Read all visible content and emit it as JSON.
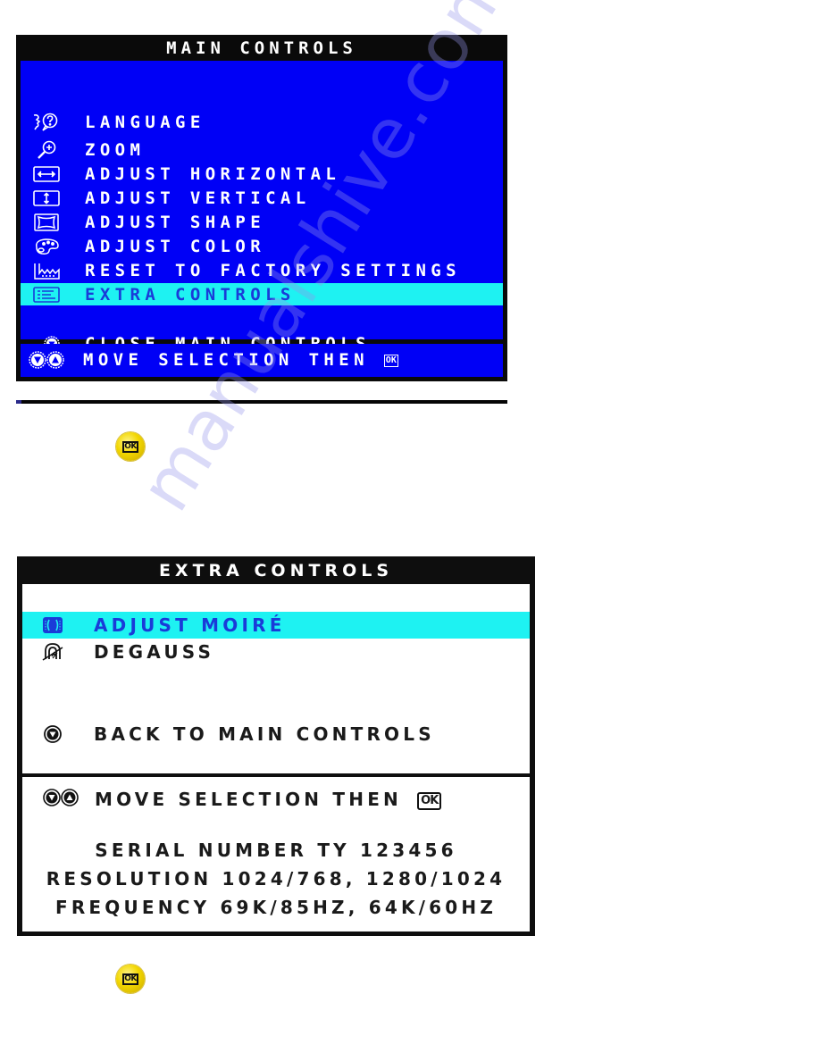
{
  "watermark": "manualshive.com",
  "main_controls": {
    "title": "MAIN CONTROLS",
    "items": [
      {
        "label": "LANGUAGE",
        "icon": "language-icon",
        "selected": false
      },
      {
        "label": "ZOOM",
        "icon": "zoom-icon",
        "selected": false
      },
      {
        "label": "ADJUST HORIZONTAL",
        "icon": "horizontal-arrows-icon",
        "selected": false
      },
      {
        "label": "ADJUST VERTICAL",
        "icon": "vertical-arrows-icon",
        "selected": false
      },
      {
        "label": "ADJUST SHAPE",
        "icon": "shape-icon",
        "selected": false
      },
      {
        "label": "ADJUST COLOR",
        "icon": "color-palette-icon",
        "selected": false
      },
      {
        "label": "RESET TO FACTORY SETTINGS",
        "icon": "factory-icon",
        "selected": false
      },
      {
        "label": "EXTRA CONTROLS",
        "icon": "extra-controls-icon",
        "selected": true
      }
    ],
    "close_label": "CLOSE MAIN CONTROLS",
    "footer_label": "MOVE SELECTION THEN",
    "footer_ok": "OK",
    "colors": {
      "background": "#0000f6",
      "frame": "#0a0a0a",
      "highlight": "#1ef2f2",
      "text": "#ffffff",
      "selected_text": "#1a3bd8"
    }
  },
  "ok_button_1": {
    "label": "OK"
  },
  "extra_controls": {
    "title": "EXTRA CONTROLS",
    "items": [
      {
        "label": "ADJUST MOIRÉ",
        "icon": "moire-icon",
        "selected": true
      },
      {
        "label": "DEGAUSS",
        "icon": "degauss-icon",
        "selected": false
      }
    ],
    "back_label": "BACK TO MAIN CONTROLS",
    "footer_label": "MOVE SELECTION THEN",
    "footer_ok": "OK",
    "info": {
      "serial": "SERIAL NUMBER TY 123456",
      "resolution": "RESOLUTION 1024/768, 1280/1024",
      "frequency": "FREQUENCY 69K/85HZ, 64K/60HZ"
    },
    "colors": {
      "background": "#ffffff",
      "frame": "#0e0e0e",
      "highlight": "#1ef2f2",
      "text": "#1a1a1a",
      "selected_text": "#1a3bd8"
    }
  },
  "ok_button_2": {
    "label": "OK"
  }
}
